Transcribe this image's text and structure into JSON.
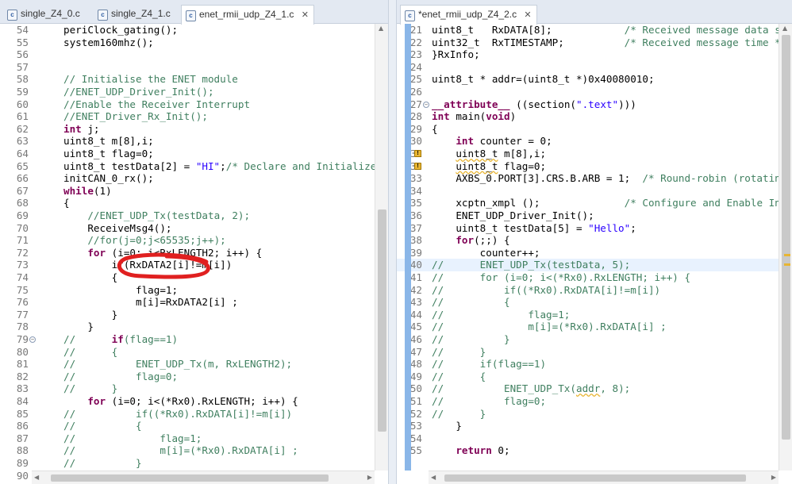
{
  "left_editor": {
    "tabs": [
      {
        "label": "single_Z4_0.c",
        "active": false
      },
      {
        "label": "single_Z4_1.c",
        "active": false
      },
      {
        "label": "enet_rmii_udp_Z4_1.c",
        "active": true
      }
    ],
    "close_glyph": "✕",
    "lines": [
      {
        "n": "54",
        "segs": [
          [
            "",
            "periClock_gating();"
          ]
        ]
      },
      {
        "n": "55",
        "segs": [
          [
            "",
            "system160mhz();"
          ]
        ]
      },
      {
        "n": "56",
        "segs": []
      },
      {
        "n": "57",
        "segs": []
      },
      {
        "n": "58",
        "segs": [
          [
            "cm",
            "// Initialise the ENET module"
          ]
        ]
      },
      {
        "n": "59",
        "segs": [
          [
            "cm",
            "//ENET_UDP_Driver_Init();"
          ]
        ]
      },
      {
        "n": "60",
        "segs": [
          [
            "cm",
            "//Enable the Receiver Interrupt"
          ]
        ]
      },
      {
        "n": "61",
        "segs": [
          [
            "cm",
            "//ENET_Driver_Rx_Init();"
          ]
        ]
      },
      {
        "n": "62",
        "segs": [
          [
            "kw",
            "int"
          ],
          [
            "",
            " j;"
          ]
        ]
      },
      {
        "n": "63",
        "segs": [
          [
            "",
            "uint8_t m[8],i;"
          ]
        ]
      },
      {
        "n": "64",
        "segs": [
          [
            "",
            "uint8_t flag=0;"
          ]
        ]
      },
      {
        "n": "65",
        "segs": [
          [
            "",
            "uint8_t testData[2] = "
          ],
          [
            "str",
            "\"HI\""
          ],
          [
            "",
            ";"
          ],
          [
            "cm",
            "/* Declare and Initialize t"
          ]
        ]
      },
      {
        "n": "66",
        "segs": [
          [
            "",
            "initCAN_0_rx();"
          ]
        ]
      },
      {
        "n": "67",
        "segs": [
          [
            "kw",
            "while"
          ],
          [
            "",
            "(1)"
          ]
        ]
      },
      {
        "n": "68",
        "segs": [
          [
            "",
            "{"
          ]
        ]
      },
      {
        "n": "69",
        "segs": [
          [
            "",
            "    "
          ],
          [
            "cm",
            "//ENET_UDP_Tx(testData, 2);"
          ]
        ]
      },
      {
        "n": "70",
        "segs": [
          [
            "",
            "    ReceiveMsg4();"
          ]
        ]
      },
      {
        "n": "71",
        "segs": [
          [
            "",
            "    "
          ],
          [
            "cm",
            "//for(j=0;j<65535;j++);"
          ]
        ]
      },
      {
        "n": "72",
        "segs": [
          [
            "",
            "    "
          ],
          [
            "kw",
            "for"
          ],
          [
            "",
            " (i=0; i<RxLENGTH2; i++) {"
          ]
        ]
      },
      {
        "n": "73",
        "segs": [
          [
            "",
            "        if(RxDATA2[i]!=m[i])"
          ]
        ]
      },
      {
        "n": "74",
        "segs": [
          [
            "",
            "        {"
          ]
        ]
      },
      {
        "n": "75",
        "segs": [
          [
            "",
            "            flag=1;"
          ]
        ]
      },
      {
        "n": "76",
        "segs": [
          [
            "",
            "            m[i]=RxDATA2[i] ;"
          ]
        ]
      },
      {
        "n": "77",
        "segs": [
          [
            "",
            "        }"
          ]
        ]
      },
      {
        "n": "78",
        "segs": [
          [
            "",
            "    }"
          ]
        ]
      },
      {
        "n": "79",
        "fold": true,
        "segs": [
          [
            "cm",
            "//"
          ],
          [
            "",
            "      "
          ],
          [
            "kw",
            "if"
          ],
          [
            "cm",
            "(flag==1)"
          ]
        ]
      },
      {
        "n": "80",
        "segs": [
          [
            "cm",
            "//      {"
          ]
        ]
      },
      {
        "n": "81",
        "segs": [
          [
            "cm",
            "//          ENET_UDP_Tx(m, RxLENGTH2);"
          ]
        ]
      },
      {
        "n": "82",
        "segs": [
          [
            "cm",
            "//          flag=0;"
          ]
        ]
      },
      {
        "n": "83",
        "segs": [
          [
            "cm",
            "//      }"
          ]
        ]
      },
      {
        "n": "84",
        "segs": [
          [
            "",
            "    "
          ],
          [
            "kw",
            "for"
          ],
          [
            "",
            " (i=0; i<(*Rx0).RxLENGTH; i++) {"
          ]
        ]
      },
      {
        "n": "85",
        "segs": [
          [
            "cm",
            "//          if((*Rx0).RxDATA[i]!=m[i])"
          ]
        ]
      },
      {
        "n": "86",
        "segs": [
          [
            "cm",
            "//          {"
          ]
        ]
      },
      {
        "n": "87",
        "segs": [
          [
            "cm",
            "//              flag=1;"
          ]
        ]
      },
      {
        "n": "88",
        "segs": [
          [
            "cm",
            "//              m[i]=(*Rx0).RxDATA[i] ;"
          ]
        ]
      },
      {
        "n": "89",
        "segs": [
          [
            "cm",
            "//          }"
          ]
        ]
      },
      {
        "n": "90",
        "segs": [
          [
            "cm",
            "//      }"
          ]
        ]
      }
    ]
  },
  "right_editor": {
    "tabs": [
      {
        "label": "*enet_rmii_udp_Z4_2.c",
        "active": true
      }
    ],
    "close_glyph": "✕",
    "lines": [
      {
        "n": "21",
        "segs": [
          [
            "",
            "uint8_t   RxDATA[8];"
          ],
          [
            "cm",
            "            /* Received message data st"
          ]
        ]
      },
      {
        "n": "22",
        "segs": [
          [
            "",
            "uint32_t  RxTIMESTAMP;"
          ],
          [
            "cm",
            "          /* Received message time */"
          ]
        ]
      },
      {
        "n": "23",
        "segs": [
          [
            "",
            "}RxInfo;"
          ]
        ]
      },
      {
        "n": "24",
        "segs": []
      },
      {
        "n": "25",
        "segs": [
          [
            "",
            "uint8_t * addr=(uint8_t *)0x40080010;"
          ]
        ]
      },
      {
        "n": "26",
        "segs": []
      },
      {
        "n": "27",
        "fold": true,
        "segs": [
          [
            "kw",
            "__attribute__"
          ],
          [
            "",
            " ((section("
          ],
          [
            "str",
            "\".text\""
          ],
          [
            "",
            ")))"
          ]
        ]
      },
      {
        "n": "28",
        "segs": [
          [
            "kw",
            "int"
          ],
          [
            "",
            " main("
          ],
          [
            "kw",
            "void"
          ],
          [
            "",
            ")"
          ]
        ]
      },
      {
        "n": "29",
        "segs": [
          [
            "",
            "{"
          ]
        ]
      },
      {
        "n": "30",
        "segs": [
          [
            "",
            "    "
          ],
          [
            "kw",
            "int"
          ],
          [
            "",
            " counter = 0;"
          ]
        ]
      },
      {
        "n": "31",
        "warn": true,
        "segs": [
          [
            "",
            "    "
          ],
          [
            "sq",
            "uint8_t"
          ],
          [
            "",
            " m[8],i;"
          ]
        ]
      },
      {
        "n": "32",
        "warn": true,
        "segs": [
          [
            "",
            "    "
          ],
          [
            "sq",
            "uint8_t"
          ],
          [
            "",
            " flag=0;"
          ]
        ]
      },
      {
        "n": "33",
        "segs": [
          [
            "",
            "    AXBS_0.PORT[3].CRS.B.ARB = 1;  "
          ],
          [
            "cm",
            "/* Round-robin (rotating"
          ]
        ]
      },
      {
        "n": "34",
        "segs": []
      },
      {
        "n": "35",
        "segs": [
          [
            "",
            "    xcptn_xmpl ();"
          ],
          [
            "cm",
            "              /* Configure and Enable Int"
          ]
        ]
      },
      {
        "n": "36",
        "segs": [
          [
            "",
            "    ENET_UDP_Driver_Init();"
          ]
        ]
      },
      {
        "n": "37",
        "segs": [
          [
            "",
            "    uint8_t testData[5] = "
          ],
          [
            "str",
            "\"Hello\""
          ],
          [
            "",
            ";"
          ]
        ]
      },
      {
        "n": "38",
        "segs": [
          [
            "",
            "    "
          ],
          [
            "kw",
            "for"
          ],
          [
            "",
            "(;;) {"
          ]
        ]
      },
      {
        "n": "39",
        "segs": [
          [
            "",
            "        counter++;"
          ]
        ]
      },
      {
        "n": "40",
        "current": true,
        "segs": [
          [
            "cm",
            "//"
          ],
          [
            "",
            "      "
          ],
          [
            "cm",
            "ENET_UDP_Tx(testData, 5);"
          ]
        ]
      },
      {
        "n": "41",
        "segs": [
          [
            "cm",
            "//      for (i=0; i<(*Rx0).RxLENGTH; i++) {"
          ]
        ]
      },
      {
        "n": "42",
        "segs": [
          [
            "cm",
            "//          if((*Rx0).RxDATA[i]!=m[i])"
          ]
        ]
      },
      {
        "n": "43",
        "segs": [
          [
            "cm",
            "//          {"
          ]
        ]
      },
      {
        "n": "44",
        "segs": [
          [
            "cm",
            "//              flag=1;"
          ]
        ]
      },
      {
        "n": "45",
        "segs": [
          [
            "cm",
            "//              m[i]=(*Rx0).RxDATA[i] ;"
          ]
        ]
      },
      {
        "n": "46",
        "segs": [
          [
            "cm",
            "//          }"
          ]
        ]
      },
      {
        "n": "47",
        "segs": [
          [
            "cm",
            "//      }"
          ]
        ]
      },
      {
        "n": "48",
        "segs": [
          [
            "cm",
            "//      if(flag==1)"
          ]
        ]
      },
      {
        "n": "49",
        "segs": [
          [
            "cm",
            "//      {"
          ]
        ]
      },
      {
        "n": "50",
        "segs": [
          [
            "cm",
            "//          ENET_UDP_Tx("
          ],
          [
            "cmsq",
            "addr"
          ],
          [
            "cm",
            ", 8);"
          ]
        ]
      },
      {
        "n": "51",
        "segs": [
          [
            "cm",
            "//          flag=0;"
          ]
        ]
      },
      {
        "n": "52",
        "segs": [
          [
            "cm",
            "//      }"
          ]
        ]
      },
      {
        "n": "53",
        "segs": [
          [
            "",
            "    }"
          ]
        ]
      },
      {
        "n": "54",
        "segs": []
      },
      {
        "n": "55",
        "segs": [
          [
            "",
            "    "
          ],
          [
            "kw",
            "return"
          ],
          [
            "",
            " 0;"
          ]
        ]
      }
    ]
  },
  "annotation": {
    "color": "#e02020"
  },
  "colors": {
    "keyword": "#7f0055",
    "comment": "#3f7f5f",
    "string": "#2a00ff",
    "warning": "#e8b533",
    "ruler": "#8ab6e8"
  }
}
